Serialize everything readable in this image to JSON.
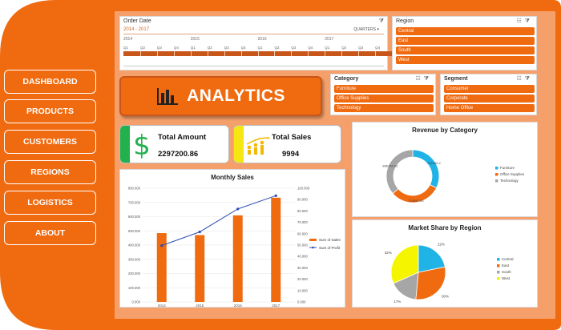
{
  "colors": {
    "accent": "#f06a10",
    "panel_bg": "#f5a06a",
    "dark_orange": "#c8561a"
  },
  "nav": {
    "items": [
      {
        "label": "DASHBOARD"
      },
      {
        "label": "PRODUCTS"
      },
      {
        "label": "CUSTOMERS"
      },
      {
        "label": "REGIONS"
      },
      {
        "label": "LOGISTICS"
      },
      {
        "label": "ABOUT"
      }
    ]
  },
  "timeline": {
    "title": "Order Date",
    "range": "2014 - 2017",
    "level": "QUARTERS",
    "years": [
      "2014",
      "2015",
      "2016",
      "2017"
    ],
    "quarters": [
      "Q1",
      "Q2",
      "Q3",
      "Q4",
      "Q1",
      "Q2",
      "Q3",
      "Q4",
      "Q1",
      "Q2",
      "Q3",
      "Q4",
      "Q1",
      "Q2",
      "Q3",
      "Q4"
    ]
  },
  "slicers": {
    "region": {
      "title": "Region",
      "items": [
        "Central",
        "East",
        "South",
        "West"
      ]
    },
    "category": {
      "title": "Category",
      "items": [
        "Furniture",
        "Office Supplies",
        "Technology"
      ]
    },
    "segment": {
      "title": "Segment",
      "items": [
        "Consumer",
        "Corporate",
        "Home Office"
      ]
    }
  },
  "banner": {
    "title": "ANALYTICS",
    "icon": "bar-chart-icon"
  },
  "kpis": {
    "amount": {
      "label": "Total Amount",
      "value": "2297200.86",
      "icon": "dollar-icon",
      "strip_color": "#22b14c"
    },
    "sales": {
      "label": "Total Sales",
      "value": "9994",
      "icon": "people-growth-icon",
      "strip_color": "#f5e614"
    }
  },
  "chart_data": [
    {
      "type": "bar",
      "title": "Monthly Sales",
      "categories": [
        "2014",
        "2015",
        "2016",
        "2017"
      ],
      "ylim": [
        0,
        800000
      ],
      "yticks_left": [
        "0.000",
        "100.000",
        "200.000",
        "300.000",
        "400.000",
        "500.000",
        "600.000",
        "700.000",
        "800.000"
      ],
      "y2lim": [
        0,
        100000
      ],
      "yticks_right": [
        "0.000",
        "10.000",
        "20.000",
        "30.000",
        "40.000",
        "50.000",
        "60.000",
        "70.000",
        "80.000",
        "90.000",
        "100.000"
      ],
      "series": [
        {
          "name": "Sum of Sales",
          "type": "bar",
          "axis": "left",
          "color": "#f06a10",
          "values": [
            484247,
            470533,
            609206,
            733215
          ]
        },
        {
          "name": "Sum of Profit",
          "type": "line",
          "axis": "right",
          "color": "#2e4db5",
          "values": [
            49544,
            61619,
            81795,
            93439
          ]
        }
      ],
      "legend": "right"
    },
    {
      "type": "pie",
      "donut": true,
      "title": "Revenue by Category",
      "labels": [
        "Furniture",
        "Office Supplies",
        "Technology"
      ],
      "values": [
        742000,
        719047,
        836154
      ],
      "data_labels": [
        "742000.2",
        "719047.03",
        "836154.03"
      ],
      "colors": [
        "#1fb3e6",
        "#f06a10",
        "#a6a6a6"
      ],
      "legend": "right"
    },
    {
      "type": "pie",
      "title": "Market Share by Region",
      "labels": [
        "Central",
        "East",
        "South",
        "West"
      ],
      "values": [
        22,
        30,
        17,
        32
      ],
      "data_labels": [
        "22%",
        "30%",
        "17%",
        "32%"
      ],
      "colors": [
        "#1fb3e6",
        "#f06a10",
        "#a6a6a6",
        "#f5f500"
      ],
      "legend": "right"
    }
  ]
}
